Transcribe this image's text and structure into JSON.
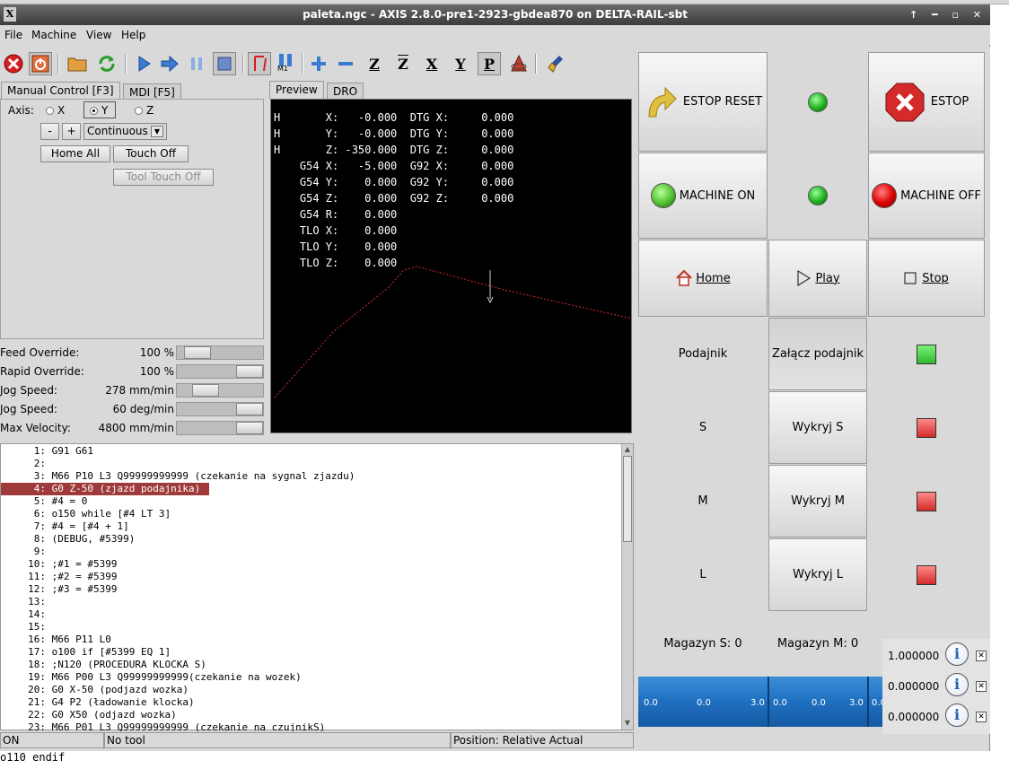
{
  "window": {
    "title": "paleta.ngc - AXIS 2.8.0-pre1-2923-gbdea870 on DELTA-RAIL-sbt",
    "controls": "↑ ━ ▫ ✕"
  },
  "menubar": [
    "File",
    "Machine",
    "View",
    "Help"
  ],
  "toolbar": {
    "icons": [
      "estop-icon",
      "power-icon",
      "open-file-icon",
      "reload-icon",
      "run-icon",
      "step-icon",
      "pause-icon",
      "stop-icon",
      "block-delete-icon",
      "optional-stop-icon",
      "zoom-in-icon",
      "zoom-out-icon",
      "view-z-icon",
      "view-z2-icon",
      "view-x-icon",
      "view-y-icon",
      "view-p-icon",
      "rotate-icon",
      "clear-plot-icon"
    ],
    "optional_stop_label": "M1",
    "view_labels": [
      "Z",
      "Z",
      "X",
      "Y",
      "P"
    ]
  },
  "left_tabs": [
    "Manual Control [F3]",
    "MDI [F5]"
  ],
  "manual": {
    "axis_label": "Axis:",
    "axes": [
      "X",
      "Y",
      "Z"
    ],
    "selected_axis": "Y",
    "minus": "-",
    "plus": "+",
    "increment": "Continuous",
    "home_all": "Home All",
    "touch_off": "Touch Off",
    "tool_touch_off": "Tool Touch Off"
  },
  "overrides": [
    {
      "label": "Feed Override:",
      "value": "100 %",
      "level": 0.12
    },
    {
      "label": "Rapid Override:",
      "value": "100 %",
      "level": 1.0
    },
    {
      "label": "Jog Speed:",
      "value": "278 mm/min",
      "level": 0.25
    },
    {
      "label": "Jog Speed:",
      "value": "60 deg/min",
      "level": 1.0
    },
    {
      "label": "Max Velocity:",
      "value": "4800 mm/min",
      "level": 1.0
    }
  ],
  "preview_tabs": [
    "Preview",
    "DRO"
  ],
  "dro_lines": [
    "H       X:   -0.000  DTG X:     0.000",
    "H       Y:   -0.000  DTG Y:     0.000",
    "H       Z: -350.000  DTG Z:     0.000",
    "    G54 X:   -5.000  G92 X:     0.000",
    "    G54 Y:    0.000  G92 Y:     0.000",
    "    G54 Z:    0.000  G92 Z:     0.000",
    "    G54 R:    0.000",
    "    TLO X:    0.000",
    "    TLO Y:    0.000",
    "    TLO Z:    0.000"
  ],
  "code_lines": [
    {
      "n": "1:",
      "t": "G91 G61"
    },
    {
      "n": "2:",
      "t": ""
    },
    {
      "n": "3:",
      "t": "M66 P10 L3 Q99999999999 (czekanie na sygnal zjazdu)"
    },
    {
      "n": "4:",
      "t": "G0 Z-50 (zjazd podajnika)",
      "hl": true
    },
    {
      "n": "5:",
      "t": "#4 = 0"
    },
    {
      "n": "6:",
      "t": "o150 while [#4 LT 3]"
    },
    {
      "n": "7:",
      "t": "#4 = [#4 + 1]"
    },
    {
      "n": "8:",
      "t": "(DEBUG, #5399)"
    },
    {
      "n": "9:",
      "t": ""
    },
    {
      "n": "10:",
      "t": ";#1 = #5399"
    },
    {
      "n": "11:",
      "t": ";#2 = #5399"
    },
    {
      "n": "12:",
      "t": ";#3 = #5399"
    },
    {
      "n": "13:",
      "t": ""
    },
    {
      "n": "14:",
      "t": ""
    },
    {
      "n": "15:",
      "t": ""
    },
    {
      "n": "16:",
      "t": "M66 P11 L0"
    },
    {
      "n": "17:",
      "t": "o100 if [#5399 EQ 1]"
    },
    {
      "n": "18:",
      "t": ";N120 (PROCEDURA KLOCKA S)"
    },
    {
      "n": "19:",
      "t": "M66 P00 L3 Q99999999999(czekanie na wozek)"
    },
    {
      "n": "20:",
      "t": "G0 X-50 (podjazd wozka)"
    },
    {
      "n": "21:",
      "t": "G4 P2 (ładowanie klocka)"
    },
    {
      "n": "22:",
      "t": "G0 X50 (odjazd wozka)"
    },
    {
      "n": "23:",
      "t": "M66 P01 L3 Q99999999999 (czekanie na czujnikS)"
    }
  ],
  "status": {
    "state": "ON",
    "tool": "No tool",
    "position": "Position: Relative Actual"
  },
  "command_line": "o110 endif",
  "panel": {
    "estop_reset": "ESTOP RESET",
    "estop": "ESTOP",
    "machine_on": "MACHINE ON",
    "machine_off": "MACHINE OFF",
    "home": "Home",
    "play": "Play",
    "stop": "Stop",
    "feeder_label": "Podajnik",
    "feeder_button": "Załącz podajnik",
    "rows": [
      {
        "label": "S",
        "button": "Wykryj S"
      },
      {
        "label": "M",
        "button": "Wykryj M"
      },
      {
        "label": "L",
        "button": "Wykryj L"
      }
    ],
    "magazyn_s": "Magazyn S: 0",
    "magazyn_m": "Magazyn M: 0",
    "bar_values": [
      "0.0",
      "0.0",
      "3.0",
      "0.0",
      "0.0",
      "3.0",
      "0.0"
    ],
    "info_values": [
      "1.000000",
      "0.000000",
      "0.000000"
    ]
  },
  "colors": {
    "code_highlight": "#9e3a3a",
    "preview_bg": "#000000",
    "bar_blue": "#1f6fc0"
  }
}
